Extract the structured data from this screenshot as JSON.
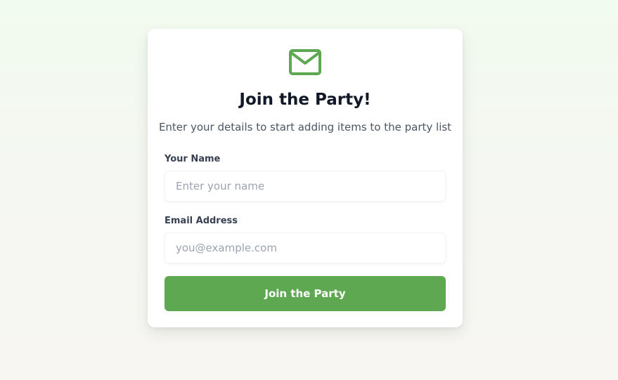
{
  "colors": {
    "accent": "#5da850",
    "title": "#111827",
    "subtitle": "#4b5563",
    "label": "#374151",
    "placeholder": "#9ca3af"
  },
  "header": {
    "icon": "mail-icon",
    "title": "Join the Party!",
    "subtitle": "Enter your details to start adding items to the party list"
  },
  "form": {
    "name": {
      "label": "Your Name",
      "placeholder": "Enter your name",
      "value": ""
    },
    "email": {
      "label": "Email Address",
      "placeholder": "you@example.com",
      "value": ""
    },
    "submit_label": "Join the Party"
  }
}
